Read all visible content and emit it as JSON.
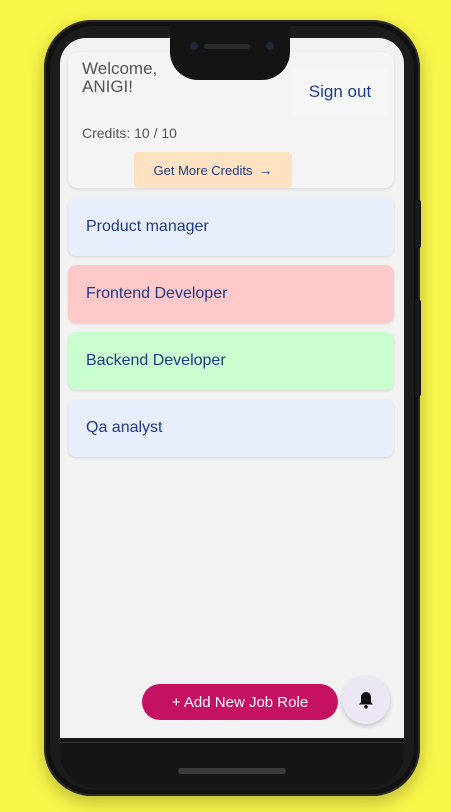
{
  "header": {
    "welcome_text": "Welcome, ANIGI!",
    "credits_text": "Credits: 10 / 10",
    "sign_out_label": "Sign out",
    "get_credits_label": "Get More Credits"
  },
  "job_roles": [
    {
      "label": "Product manager",
      "color": "#e8eefc"
    },
    {
      "label": "Frontend Developer",
      "color": "#ffc9c9"
    },
    {
      "label": "Backend Developer",
      "color": "#c9ffcf"
    },
    {
      "label": "Qa analyst",
      "color": "#e8eefc"
    }
  ],
  "actions": {
    "add_job_role_label": "+ Add New Job Role",
    "bell_icon": "bell-icon"
  },
  "colors": {
    "background": "#f9f64a",
    "accent": "#c51162",
    "text_primary": "#1e3a8a"
  }
}
